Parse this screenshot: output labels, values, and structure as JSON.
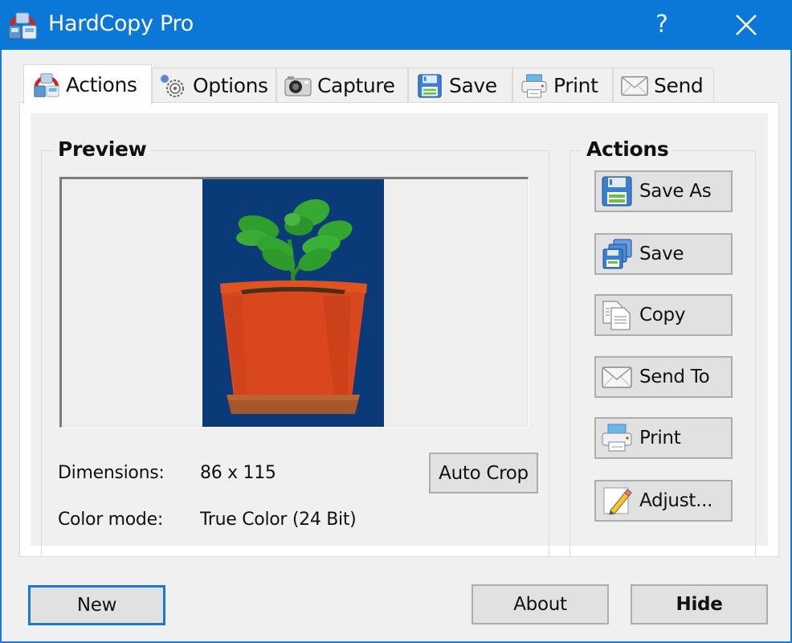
{
  "window": {
    "title": "HardCopy Pro",
    "help_label": "?",
    "close_icon": "close-icon",
    "app_icon": "hardcopy-app-icon"
  },
  "tabs": [
    {
      "label": "Actions",
      "icon": "actions-icon",
      "active": true
    },
    {
      "label": "Options",
      "icon": "gear-icon",
      "active": false
    },
    {
      "label": "Capture",
      "icon": "camera-icon",
      "active": false
    },
    {
      "label": "Save",
      "icon": "floppy-disk-icon",
      "active": false
    },
    {
      "label": "Print",
      "icon": "printer-icon",
      "active": false
    },
    {
      "label": "Send",
      "icon": "envelope-icon",
      "active": false
    }
  ],
  "preview": {
    "title": "Preview",
    "image_description": "potted plant on blue background",
    "dimensions_label": "Dimensions:",
    "dimensions_value": "86 x 115",
    "color_mode_label": "Color mode:",
    "color_mode_value": "True Color (24 Bit)",
    "auto_crop_label": "Auto Crop"
  },
  "actions": {
    "title": "Actions",
    "buttons": [
      {
        "label": "Save As",
        "icon": "save-as-icon"
      },
      {
        "label": "Save",
        "icon": "save-multiple-icon"
      },
      {
        "label": "Copy",
        "icon": "copy-icon"
      },
      {
        "label": "Send To",
        "icon": "envelope-icon"
      },
      {
        "label": "Print",
        "icon": "printer-icon"
      },
      {
        "label": "Adjust...",
        "icon": "pencil-icon"
      }
    ]
  },
  "footer": {
    "new_label": "New",
    "about_label": "About",
    "hide_label": "Hide"
  },
  "colors": {
    "titlebar": "#0b78d7",
    "preview_background": "#0b3a78",
    "default_button_border": "#1b78d6"
  }
}
